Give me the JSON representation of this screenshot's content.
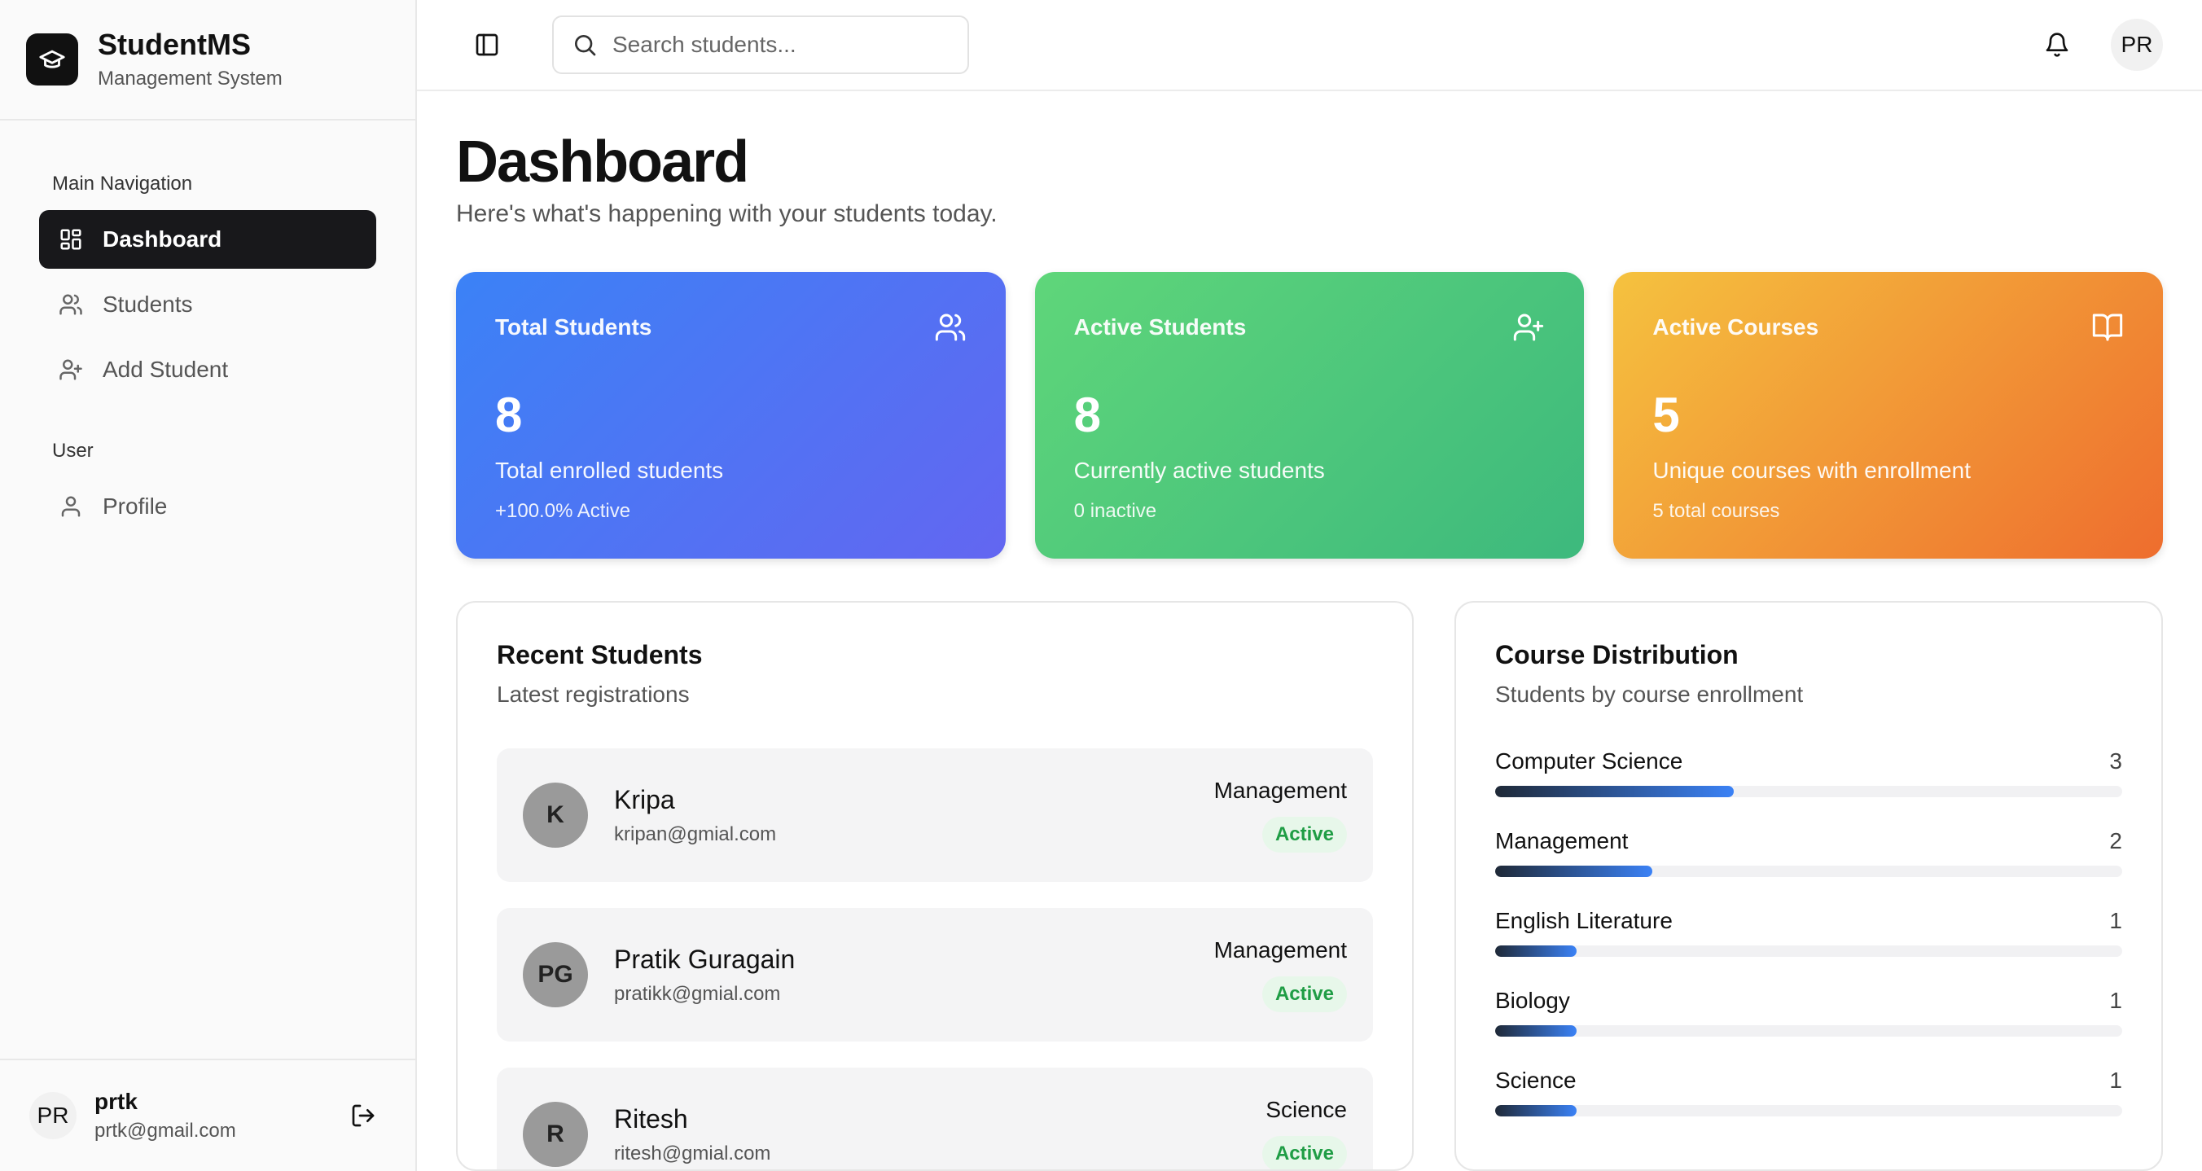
{
  "brand": {
    "name": "StudentMS",
    "subtitle": "Management System"
  },
  "nav": {
    "main_label": "Main Navigation",
    "items": [
      {
        "label": "Dashboard",
        "icon": "grid-icon",
        "active": true
      },
      {
        "label": "Students",
        "icon": "users-icon",
        "active": false
      },
      {
        "label": "Add Student",
        "icon": "user-plus-icon",
        "active": false
      }
    ],
    "user_label": "User",
    "user_items": [
      {
        "label": "Profile",
        "icon": "user-icon"
      }
    ]
  },
  "footer_user": {
    "initials": "PR",
    "name": "prtk",
    "email": "prtk@gmail.com"
  },
  "topbar": {
    "search_placeholder": "Search students...",
    "avatar_initials": "PR"
  },
  "page": {
    "title": "Dashboard",
    "subtitle": "Here's what's happening with your students today."
  },
  "stats": [
    {
      "label": "Total Students",
      "value": "8",
      "desc": "Total enrolled students",
      "foot": "+100.0% Active",
      "icon": "users-icon",
      "color": "#3b82f6"
    },
    {
      "label": "Active Students",
      "value": "8",
      "desc": "Currently active students",
      "foot": "0 inactive",
      "icon": "user-plus-icon",
      "color": "#4ade80"
    },
    {
      "label": "Active Courses",
      "value": "5",
      "desc": "Unique courses with enrollment",
      "foot": "5 total courses",
      "icon": "book-open-icon",
      "color": "#f59e0b"
    }
  ],
  "recent": {
    "title": "Recent Students",
    "subtitle": "Latest registrations",
    "students": [
      {
        "initials": "K",
        "name": "Kripa",
        "email": "kripan@gmial.com",
        "course": "Management",
        "status": "Active"
      },
      {
        "initials": "PG",
        "name": "Pratik Guragain",
        "email": "pratikk@gmial.com",
        "course": "Management",
        "status": "Active"
      },
      {
        "initials": "R",
        "name": "Ritesh",
        "email": "ritesh@gmial.com",
        "course": "Science",
        "status": "Active"
      }
    ]
  },
  "distribution": {
    "title": "Course Distribution",
    "subtitle": "Students by course enrollment",
    "courses": [
      {
        "name": "Computer Science",
        "count": "3",
        "fraction": 0.38
      },
      {
        "name": "Management",
        "count": "2",
        "fraction": 0.25
      },
      {
        "name": "English Literature",
        "count": "1",
        "fraction": 0.13
      },
      {
        "name": "Biology",
        "count": "1",
        "fraction": 0.13
      },
      {
        "name": "Science",
        "count": "1",
        "fraction": 0.13
      }
    ]
  }
}
